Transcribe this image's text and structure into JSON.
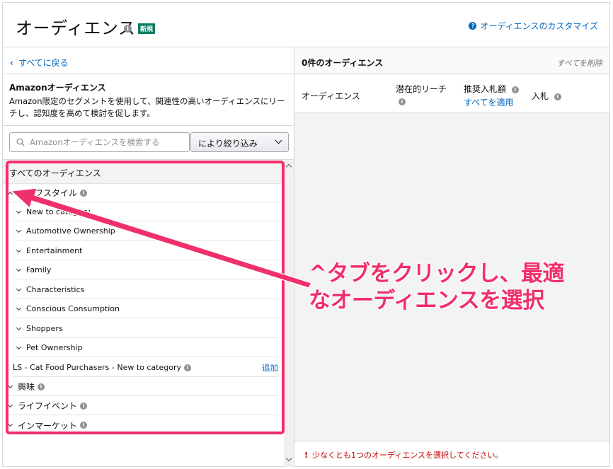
{
  "header": {
    "title": "オーディエンス",
    "badge": "新規",
    "customize_link": "オーディエンスのカスタマイズ"
  },
  "left": {
    "back_label": "すべてに戻る",
    "desc_title": "Amazonオーディエンス",
    "desc_text": "Amazon限定のセグメントを使用して、関連性の高いオーディエンスにリーチし、認知度を高めて検討を促します。",
    "search_placeholder": "Amazonオーディエンスを検索する",
    "filter_label": "により絞り込み",
    "all_header": "すべてのオーディエンス",
    "tree": {
      "lifestyle": "ライフスタイル",
      "sub_items": [
        "New to category",
        "Automotive Ownership",
        "Entertainment",
        "Family",
        "Characteristics",
        "Conscious Consumption",
        "Shoppers",
        "Pet Ownership"
      ],
      "leaf": "LS - Cat Food Purchasers - New to category",
      "add_label": "追加",
      "interest": "興味",
      "life_event": "ライフイベント",
      "in_market": "インマーケット"
    }
  },
  "right": {
    "count_label": "0件のオーディエンス",
    "remove_all": "すべてを削除",
    "col_audience": "オーディエンス",
    "col_reach": "潜在的リーチ",
    "col_bid": "推奨入札額",
    "col_bid_apply": "すべてを適用",
    "col_entry": "入札",
    "warning": "少なくとも1つのオーディエンスを選択してください。"
  },
  "annotation": {
    "line1": "^タブをクリックし、最適",
    "line2": "なオーディエンスを選択",
    "color": "#f0306a"
  },
  "colors": {
    "link": "#0066c0",
    "badge": "#067d62",
    "warning": "#c40000"
  }
}
